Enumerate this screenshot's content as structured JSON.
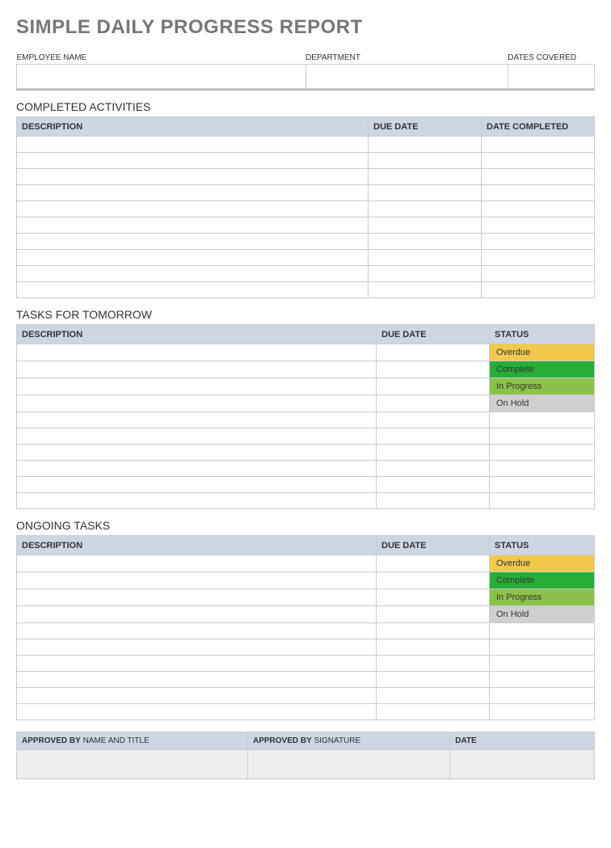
{
  "title": "SIMPLE DAILY PROGRESS REPORT",
  "info": {
    "employee_label": "EMPLOYEE NAME",
    "department_label": "DEPARTMENT",
    "dates_label": "DATES COVERED",
    "employee_value": "",
    "department_value": "",
    "dates_value": ""
  },
  "completed": {
    "title": "COMPLETED ACTIVITIES",
    "headers": {
      "description": "DESCRIPTION",
      "due": "DUE DATE",
      "date": "DATE COMPLETED"
    },
    "rows": [
      {
        "desc": "",
        "due": "",
        "date": ""
      },
      {
        "desc": "",
        "due": "",
        "date": ""
      },
      {
        "desc": "",
        "due": "",
        "date": ""
      },
      {
        "desc": "",
        "due": "",
        "date": ""
      },
      {
        "desc": "",
        "due": "",
        "date": ""
      },
      {
        "desc": "",
        "due": "",
        "date": ""
      },
      {
        "desc": "",
        "due": "",
        "date": ""
      },
      {
        "desc": "",
        "due": "",
        "date": ""
      },
      {
        "desc": "",
        "due": "",
        "date": ""
      },
      {
        "desc": "",
        "due": "",
        "date": ""
      }
    ]
  },
  "tomorrow": {
    "title": "TASKS FOR TOMORROW",
    "headers": {
      "description": "DESCRIPTION",
      "due": "DUE DATE",
      "status": "STATUS"
    },
    "rows": [
      {
        "desc": "",
        "due": "",
        "status": "Overdue",
        "class": "status-overdue"
      },
      {
        "desc": "",
        "due": "",
        "status": "Complete",
        "class": "status-complete"
      },
      {
        "desc": "",
        "due": "",
        "status": "In Progress",
        "class": "status-inprogress"
      },
      {
        "desc": "",
        "due": "",
        "status": "On Hold",
        "class": "status-onhold"
      },
      {
        "desc": "",
        "due": "",
        "status": "",
        "class": ""
      },
      {
        "desc": "",
        "due": "",
        "status": "",
        "class": ""
      },
      {
        "desc": "",
        "due": "",
        "status": "",
        "class": ""
      },
      {
        "desc": "",
        "due": "",
        "status": "",
        "class": ""
      },
      {
        "desc": "",
        "due": "",
        "status": "",
        "class": ""
      },
      {
        "desc": "",
        "due": "",
        "status": "",
        "class": ""
      }
    ]
  },
  "ongoing": {
    "title": "ONGOING TASKS",
    "headers": {
      "description": "DESCRIPTION",
      "due": "DUE DATE",
      "status": "STATUS"
    },
    "rows": [
      {
        "desc": "",
        "due": "",
        "status": "Overdue",
        "class": "status-overdue"
      },
      {
        "desc": "",
        "due": "",
        "status": "Complete",
        "class": "status-complete"
      },
      {
        "desc": "",
        "due": "",
        "status": "In Progress",
        "class": "status-inprogress"
      },
      {
        "desc": "",
        "due": "",
        "status": "On Hold",
        "class": "status-onhold"
      },
      {
        "desc": "",
        "due": "",
        "status": "",
        "class": ""
      },
      {
        "desc": "",
        "due": "",
        "status": "",
        "class": ""
      },
      {
        "desc": "",
        "due": "",
        "status": "",
        "class": ""
      },
      {
        "desc": "",
        "due": "",
        "status": "",
        "class": ""
      },
      {
        "desc": "",
        "due": "",
        "status": "",
        "class": ""
      },
      {
        "desc": "",
        "due": "",
        "status": "",
        "class": ""
      }
    ]
  },
  "approval": {
    "approved_by_bold": "APPROVED BY",
    "approved_by_rest": " NAME AND TITLE",
    "signature_bold": "APPROVED BY",
    "signature_rest": " SIGNATURE",
    "date_bold": "DATE",
    "approved_by_value": "",
    "signature_value": "",
    "date_value": ""
  }
}
